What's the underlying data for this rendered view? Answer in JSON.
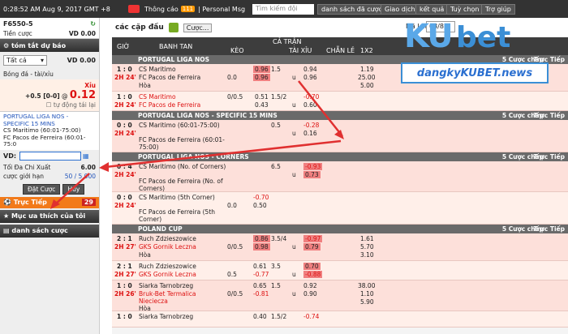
{
  "topbar": {
    "time": "0:28:52 AM Aug 9, 2017 GMT +8",
    "notice": "Thông cáo",
    "notice_count": "111",
    "pm": "Personal Msg",
    "search_placeholder": "Tìm kiếm đội",
    "buttons": [
      "danh sách đã cược",
      "Giao dịch",
      "kết quả",
      "Tuỳ chọn",
      "Trợ giúp"
    ]
  },
  "left": {
    "account": "F6550-5",
    "credit_label": "Tiền cược",
    "credit_value": "VD 0.00",
    "summary_title": "tóm tắt dự báo",
    "select_value": "Tất cả",
    "vd_label": "VD 0.00",
    "section": "Bóng đá - tài/xỉu",
    "bet_side": "Xỉu",
    "bet_hdp": "+0.5 [0-0]",
    "bet_at": "@",
    "bet_odds": "0.12",
    "auto_accept": "tự động tái lại",
    "league": "PORTUGAL LIGA NOS - SPECIFIC 15 MINS",
    "match1": "CS Maritimo (60:01-75:00)",
    "match2": "FC Pacos de Ferreira (60:01-75:0",
    "vd_input_label": "VD:",
    "max_label": "Tối Đa Chi Xuất",
    "max_value": "6.00",
    "limit_label": "cược giới hạn",
    "limit_value": "50 / 5,000",
    "place_btn": "Đặt Cược",
    "cancel_btn": "Hủy",
    "live_label": "Trực Tiếp",
    "live_count": "29",
    "fav": "Mục ưa thích của tôi",
    "betlist": "danh sách cược"
  },
  "main": {
    "match_type": "các cặp đấu",
    "custom_btn": "Cược...",
    "ma_lai": "Mã Lai",
    "page": "03/83",
    "headers": {
      "time": "GIỜ",
      "team": "BANH TAN",
      "full": "CẢ TRẬN",
      "keo": "KÈO",
      "taixiu": "TÀI XỈU",
      "chanle": "CHẴN LẺ",
      "x12": "1X2"
    },
    "groups": [
      {
        "name": "PORTUGAL LIGA NOS",
        "more": "5 Cược chấp",
        "live": "Trực Tiếp"
      },
      {
        "name": "PORTUGAL LIGA NOS - SPECIFIC 15 MINS",
        "more": "5 Cược chấp",
        "live": "Trực Tiếp"
      },
      {
        "name": "PORTUGAL LIGA NOS - CORNERS",
        "more": "5 Cược chấp",
        "live": "Trực Tiếp"
      },
      {
        "name": "POLAND CUP",
        "more": "5 Cược chấp",
        "live": "Trực Tiếp"
      }
    ],
    "rows": [
      {
        "score": "1 : 0",
        "time": "2H 24'",
        "home": "CS Maritimo",
        "away": "FC Pacos de Ferreira",
        "draw": "Hòa",
        "hdp": "0.0",
        "h1": "0.96",
        "h2": "0.96",
        "ou": "1.5",
        "u": "u",
        "o1": "0.94",
        "o2": "0.96",
        "x1": "1.19",
        "x2": "25.00",
        "x3": "5.00"
      },
      {
        "score": "1 : 0",
        "time": "2H 24'",
        "home": "CS Maritimo",
        "away": "FC Pacos de Ferreira",
        "hdp": "0/0.5",
        "h1": "0.51",
        "h2": "0.43",
        "ou": "1.5/2",
        "u": "u",
        "o1": "-0.70",
        "o2": "0.60"
      },
      {
        "score": "0 : 0",
        "time": "2H 24'",
        "home": "CS Maritimo (60:01-75:00)",
        "away": "FC Pacos de Ferreira (60:01-75:00)",
        "ou": "0.5",
        "u": "u",
        "o1": "-0.28",
        "o2": "0.16"
      },
      {
        "score": "0 : 4",
        "time": "2H 24'",
        "home": "CS Maritimo (No. of Corners)",
        "away": "FC Pacos de Ferreira (No. of Corners)",
        "ou": "6.5",
        "u": "u",
        "o1": "-0.93",
        "o2": "0.73"
      },
      {
        "score": "0 : 0",
        "time": "2H 24'",
        "home": "CS Maritimo (5th Corner)",
        "away": "FC Pacos de Ferreira (5th Corner)",
        "hdp": "0.0",
        "h1": "-0.70",
        "h2": "0.50"
      },
      {
        "score": "2 : 1",
        "time": "2H 27'",
        "home": "Ruch Zdzieszowice",
        "away": "GKS Gornik Leczna",
        "draw": "Hòa",
        "hdp": "0/0.5",
        "h1": "0.86",
        "h2": "0.98",
        "ou": "3.5/4",
        "u": "u",
        "o1": "-0.97",
        "o2": "0.79",
        "x1": "1.61",
        "x2": "5.70",
        "x3": "3.10"
      },
      {
        "score": "2 : 1",
        "time": "2H 27'",
        "home": "Ruch Zdzieszowice",
        "away": "GKS Gornik Leczna",
        "hdp": "0.5",
        "h1": "0.61",
        "h2": "-0.77",
        "ou": "3.5",
        "u": "u",
        "o1": "0.70",
        "o2": "-0.88"
      },
      {
        "score": "1 : 0",
        "time": "2H 26'",
        "home": "Siarka Tarnobrzeg",
        "away": "Bruk-Bet Termalica Nieciecza",
        "draw": "Hòa",
        "hdp": "0/0.5",
        "h1": "0.65",
        "h2": "-0.81",
        "ou": "1.5",
        "u": "u",
        "o1": "0.92",
        "o2": "0.90",
        "x1": "38.00",
        "x2": "1.10",
        "x3": "5.90"
      },
      {
        "score": "1 : 0",
        "time": "2H 26'",
        "home": "Siarka Tarnobrzeg",
        "hdp": "",
        "h1": "0.40",
        "ou": "1.5/2",
        "o1": "-0.74"
      }
    ]
  },
  "watermark": {
    "brand_k": "KU",
    "brand_b": "bet",
    "site": "dangkyKUBET.news"
  }
}
